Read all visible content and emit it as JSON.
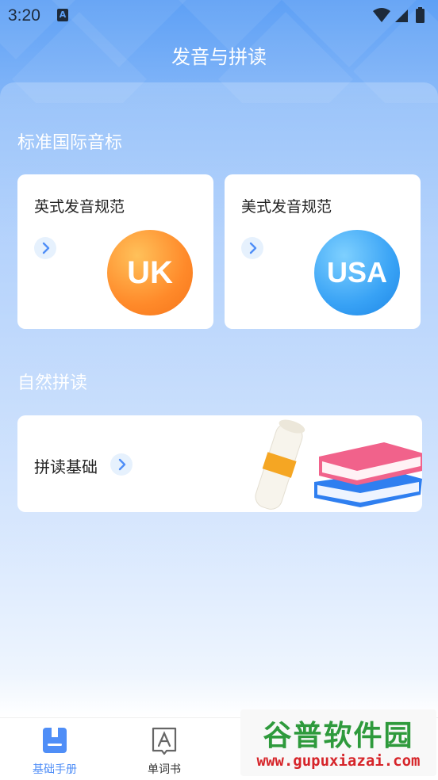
{
  "status_bar": {
    "time": "3:20",
    "notification_icon": "A"
  },
  "header": {
    "title": "发音与拼读"
  },
  "sections": {
    "phonetics": {
      "title": "标准国际音标",
      "cards": [
        {
          "title": "英式发音规范",
          "badge": "UK",
          "badge_color": "#ff8a2a"
        },
        {
          "title": "美式发音规范",
          "badge": "USA",
          "badge_color": "#38a2f5"
        }
      ]
    },
    "phonics": {
      "title": "自然拼读",
      "card": {
        "title": "拼读基础"
      }
    }
  },
  "bottom_nav": {
    "items": [
      {
        "label": "基础手册",
        "icon": "handbook-icon",
        "active": true
      },
      {
        "label": "单词书",
        "icon": "word-book-icon",
        "active": false
      }
    ]
  },
  "watermark": {
    "title": "谷普软件园",
    "url": "www.gupuxiazai.com"
  },
  "colors": {
    "accent": "#4f8ef7",
    "header_bg": "#5ea0f5",
    "watermark_green": "#2e9a3c",
    "watermark_red": "#d6252a"
  }
}
